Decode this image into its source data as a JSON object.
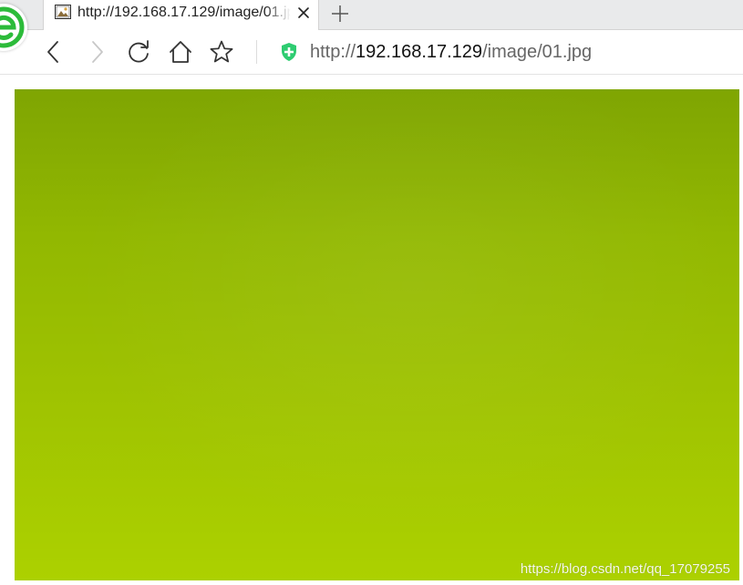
{
  "tab": {
    "title": "http://192.168.17.129/image/01.jpg",
    "favicon": "image-file-icon",
    "close_icon": "close-icon"
  },
  "new_tab": {
    "icon": "plus-icon",
    "symbol": "+"
  },
  "toolbar": {
    "back_icon": "back-arrow-icon",
    "forward_icon": "forward-arrow-icon",
    "reload_icon": "reload-icon",
    "home_icon": "home-icon",
    "bookmark_icon": "star-icon",
    "secure_icon": "green-shield-icon"
  },
  "address": {
    "scheme": "http://",
    "host": "192.168.17.129",
    "path": "/image/01.jpg"
  },
  "content": {
    "image_alt": "green-gradient-image",
    "watermark": "https://blog.csdn.net/qq_17079255"
  },
  "colors": {
    "image_top": "#7fa502",
    "image_bottom": "#acd100",
    "secure_green": "#2ecc71",
    "browser_logo_green": "#2cbb3a"
  }
}
